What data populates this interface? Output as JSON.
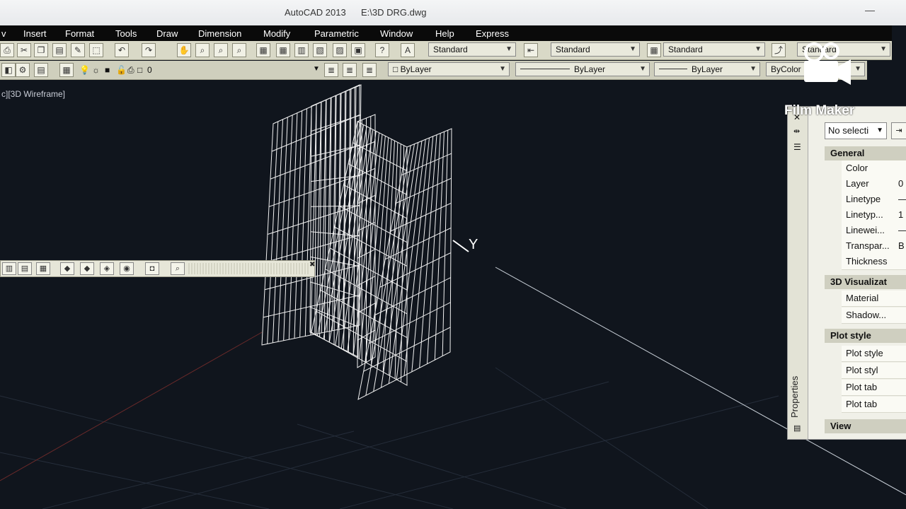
{
  "window": {
    "app_title": "AutoCAD 2013",
    "file_title": "E:\\3D DRG.dwg",
    "minimize_glyph": "—"
  },
  "menu": {
    "items": [
      "v",
      "Insert",
      "Format",
      "Tools",
      "Draw",
      "Dimension",
      "Modify",
      "Parametric",
      "Window",
      "Help",
      "Express"
    ]
  },
  "styles_toolbar": {
    "text_style": "Standard",
    "dim_style": "Standard",
    "table_style": "Standard",
    "multileader_style": "Standard"
  },
  "layers_toolbar": {
    "current_layer": "0",
    "color": "ByLayer",
    "linetype": "ByLayer",
    "lineweight": "ByLayer",
    "plotstyle": "ByColor"
  },
  "viewport": {
    "label": "c][3D Wireframe]",
    "axis_label": "Y"
  },
  "properties_palette": {
    "title": "Properties",
    "selection": "No selecti",
    "sections": {
      "general": "General",
      "visualization": "3D Visualizat",
      "plot_style": "Plot style",
      "view": "View"
    },
    "general_rows": [
      {
        "name": "Color",
        "value": ""
      },
      {
        "name": "Layer",
        "value": "0"
      },
      {
        "name": "Linetype",
        "value": "—"
      },
      {
        "name": "Linetyp...",
        "value": "1"
      },
      {
        "name": "Linewei...",
        "value": "—"
      },
      {
        "name": "Transpar...",
        "value": "B"
      },
      {
        "name": "Thickness",
        "value": ""
      }
    ],
    "visualization_rows": [
      {
        "name": "Material"
      },
      {
        "name": "Shadow..."
      }
    ],
    "plot_rows": [
      {
        "name": "Plot style"
      },
      {
        "name": "Plot styl"
      },
      {
        "name": "Plot tab"
      },
      {
        "name": "Plot tab"
      }
    ]
  },
  "watermark": {
    "text": "Film Maker"
  },
  "colors": {
    "viewport_bg": "#10151d",
    "toolbar_bg": "#d9d9c7",
    "menubar_bg": "#0a0a0a",
    "wireframe": "#f2f2f2",
    "grid_line": "#2a3342"
  }
}
